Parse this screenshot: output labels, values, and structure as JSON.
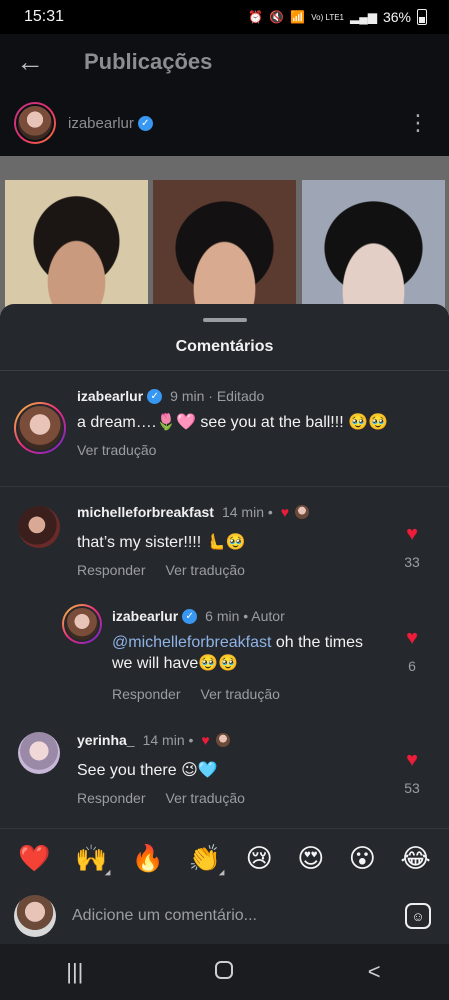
{
  "status_bar": {
    "time": "15:31",
    "battery": "36%",
    "network": "Vo) LTE1"
  },
  "header": {
    "title": "Publicações"
  },
  "post": {
    "username": "izabearlur"
  },
  "sheet": {
    "title": "Comentários"
  },
  "comments": [
    {
      "username": "izabearlur",
      "meta": "9 min · Editado",
      "text": "a dream….🌷🩷 see you at the ball!!! 🥹🥹",
      "actions": [
        "Ver tradução"
      ]
    },
    {
      "username": "michelleforbreakfast",
      "meta": "14 min •",
      "text": "that’s my sister!!!! 🫷🥹",
      "actions": [
        "Responder",
        "Ver tradução"
      ],
      "likes": "33"
    },
    {
      "username": "izabearlur",
      "meta": "6 min • Autor",
      "mention": "@michelleforbreakfast",
      "text_line1": " oh the times",
      "text_line2": "we will have🥹🥹",
      "actions": [
        "Responder",
        "Ver tradução"
      ],
      "likes": "6"
    },
    {
      "username": "yerinha_",
      "meta": "14 min •",
      "text": "See you there 😉🩵",
      "actions": [
        "Responder",
        "Ver tradução"
      ],
      "likes": "53"
    }
  ],
  "reactions": [
    "❤️",
    "🙌",
    "🔥",
    "👏",
    "😢",
    "😍",
    "😮",
    "😂"
  ],
  "composer": {
    "placeholder": "Adicione um comentário..."
  },
  "nav": {
    "recent": "|||",
    "back": "<"
  },
  "colors": {
    "background": "#25282d",
    "like": "#ed1c3a",
    "mention": "#8fb3e6",
    "verified": "#3897f0"
  }
}
